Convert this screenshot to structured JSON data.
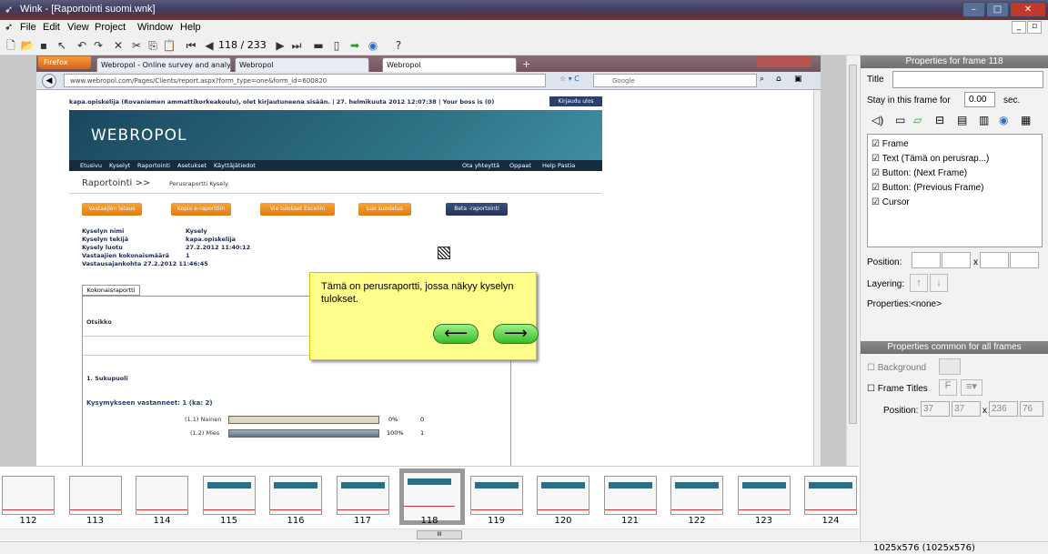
{
  "window": {
    "title": "Wink - [Raportointi suomi.wnk]"
  },
  "menu": [
    "File",
    "Edit",
    "View",
    "Project",
    "Window",
    "Help"
  ],
  "toolbar": {
    "frame_counter": "118 / 233"
  },
  "browser": {
    "firefox_label": "Firefox",
    "tabs": [
      "Webropol - Online survey and analysi...",
      "Webropol",
      "Webropol"
    ],
    "new_tab": "+",
    "url": "www.webropol.com/Pages/Clients/report.aspx?form_type=one&form_id=600820",
    "search_placeholder": "Google"
  },
  "webpage": {
    "login_text": "kapa.opiskelija (Rovaniemen ammattikorkeakoulu), olet kirjautuneena sisään. | 27. helmikuuta 2012 12:07:38 | Your boss is (0)",
    "logout": "Kirjaudu ulos",
    "logo": "WEB̲POL",
    "logo_text": "WEBROPOL",
    "nav": [
      "Etusivu",
      "Kyselyt",
      "Raportointi",
      "Asetukset",
      "Käyttäjätiedot"
    ],
    "nav_right": [
      "Ota yhteyttä",
      "Oppaat",
      "Help Pastia"
    ],
    "heading": "Raportointi >>",
    "subheading": "Perusraportti Kysely",
    "buttons": [
      "Vastaajien lataus",
      "Kopio e-raporttiin",
      "Vie tulokset Exceliin",
      "Luo suodatus",
      "Beta -raportointi"
    ],
    "info": [
      {
        "k": "Kyselyn nimi",
        "v": "Kysely"
      },
      {
        "k": "Kyselyn tekijä",
        "v": "kapa.opiskelija"
      },
      {
        "k": "Kysely luotu",
        "v": "27.2.2012 11:40:12"
      },
      {
        "k": "Vastaajien kokonaismäärä",
        "v": "1"
      }
    ],
    "answer_end": "Vastausajankohta 27.2.2012 11:46:45",
    "tab": "Kokonaisraportti",
    "col_header": "Otsikko",
    "question": "1. Sukupuoli",
    "answered": "Kysymykseen vastanneet: 1 (ka: 2)",
    "rows": [
      {
        "label": "(1.1) Nainen",
        "pct": "0%",
        "n": "0",
        "fill": 0
      },
      {
        "label": "(1.2) Mies",
        "pct": "100%",
        "n": "1",
        "fill": 1
      }
    ]
  },
  "callout": {
    "text": "Tämä on perusraportti, jossa näkyy kyselyn tulokset.",
    "prev": "⟵",
    "next": "⟶"
  },
  "props": {
    "header": "Properties for frame 118",
    "title_label": "Title",
    "stay_label": "Stay in this frame for",
    "stay_value": "0.00",
    "stay_unit": "sec.",
    "items": [
      "Frame",
      "Text (Tämä on perusrap...)",
      "Button: (Next Frame)",
      "Button: (Previous Frame)",
      "Cursor"
    ],
    "position_label": "Position:",
    "x_label": "x",
    "layering_label": "Layering:",
    "properties_label": "Properties:",
    "properties_value": "<none>",
    "common_header": "Properties common for all frames",
    "background_label": "Background",
    "frame_titles_label": "Frame Titles",
    "pos2_label": "Position:",
    "pos2": [
      "37",
      "37",
      "236",
      "76"
    ],
    "font_btn": "F"
  },
  "filmstrip": {
    "frames": [
      "112",
      "113",
      "114",
      "115",
      "116",
      "117",
      "118",
      "119",
      "120",
      "121",
      "122",
      "123",
      "124"
    ],
    "scroll_grip": "III"
  },
  "status": {
    "resolution": "1025x576 (1025x576)"
  }
}
